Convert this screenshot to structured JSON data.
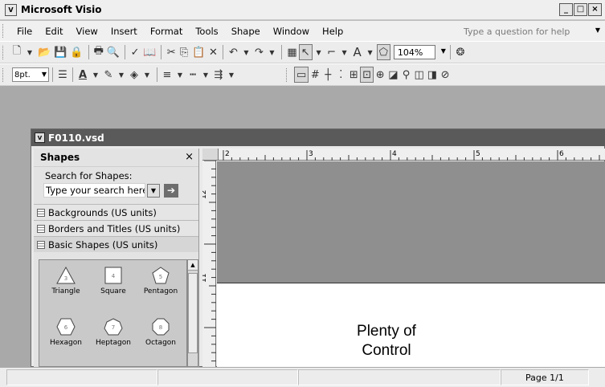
{
  "window": {
    "title": "Microsoft Visio",
    "min": "_",
    "max": "□",
    "close": "×"
  },
  "menu": [
    "File",
    "Edit",
    "View",
    "Insert",
    "Format",
    "Tools",
    "Shape",
    "Window",
    "Help"
  ],
  "ask_placeholder": "Type a question for help",
  "zoom": "104%",
  "font_size": "8pt.",
  "document": {
    "title": "F0110.vsd"
  },
  "shapes_pane": {
    "title": "Shapes",
    "close": "×",
    "search_label": "Search for Shapes:",
    "search_placeholder": "Type your search here",
    "stencils": [
      "Backgrounds (US units)",
      "Borders and Titles (US units)",
      "Basic Shapes (US units)"
    ],
    "masters": [
      {
        "label": "Triangle",
        "num": "3"
      },
      {
        "label": "Square",
        "num": "4"
      },
      {
        "label": "Pentagon",
        "num": "5"
      },
      {
        "label": "Hexagon",
        "num": "6"
      },
      {
        "label": "Heptagon",
        "num": "7"
      },
      {
        "label": "Octagon",
        "num": "8"
      }
    ]
  },
  "rulers": {
    "h_labels": [
      "2",
      "3",
      "4",
      "5",
      "6"
    ],
    "v_labels": [
      "12",
      "11"
    ]
  },
  "canvas_text": [
    "Plenty of",
    "Control"
  ],
  "status": {
    "page": "Page 1/1"
  }
}
